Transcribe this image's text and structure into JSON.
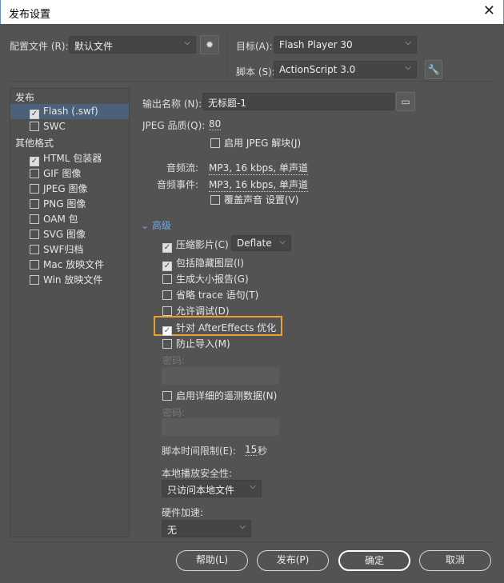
{
  "window": {
    "title": "发布设置",
    "close": "✕"
  },
  "top": {
    "profile_label": "配置文件 (R):",
    "profile_value": "默认文件",
    "target_label": "目标(A):",
    "target_value": "Flash Player 30",
    "script_label": "脚本 (S):",
    "script_value": "ActionScript 3.0"
  },
  "sidebar": {
    "publish_header": "发布",
    "publish_items": [
      {
        "label": "Flash (.swf)",
        "checked": true
      },
      {
        "label": "SWC",
        "checked": false
      }
    ],
    "other_header": "其他格式",
    "other_items": [
      {
        "label": "HTML 包装器",
        "checked": true
      },
      {
        "label": "GIF 图像",
        "checked": false
      },
      {
        "label": "JPEG 图像",
        "checked": false
      },
      {
        "label": "PNG 图像",
        "checked": false
      },
      {
        "label": "OAM 包",
        "checked": false
      },
      {
        "label": "SVG 图像",
        "checked": false
      },
      {
        "label": "SWF归档",
        "checked": false
      },
      {
        "label": "Mac 放映文件",
        "checked": false
      },
      {
        "label": "Win 放映文件",
        "checked": false
      }
    ]
  },
  "main": {
    "output_label": "输出名称 (N):",
    "output_value": "无标题-1",
    "jpeg_label": "JPEG 品质(Q):",
    "jpeg_value": "80",
    "jpeg_deblock": "启用 JPEG 解块(J)",
    "audio_stream_label": "音频流:",
    "audio_stream_value": "MP3, 16 kbps, 单声道",
    "audio_event_label": "音频事件:",
    "audio_event_value": "MP3, 16 kbps, 单声道",
    "override_sound": "覆盖声音 设置(V)",
    "advanced": "高级",
    "compress": "压缩影片(C)",
    "compress_value": "Deflate",
    "include_hidden": "包括隐藏图层(I)",
    "size_report": "生成大小报告(G)",
    "omit_trace": "省略 trace 语句(T)",
    "allow_debug": "允许调试(D)",
    "ae_optimize": "针对 AfterEffects 优化",
    "protect_import": "防止导入(M)",
    "password1": "密码:",
    "telemetry": "启用详细的遥测数据(N)",
    "password2": "密码:",
    "script_time_label": "脚本时间限制(E):",
    "script_time_value": "15",
    "script_time_unit": "秒",
    "local_security_label": "本地播放安全性:",
    "local_security_value": "只访问本地文件",
    "hw_accel_label": "硬件加速:",
    "hw_accel_value": "无"
  },
  "buttons": {
    "help": "帮助(L)",
    "publish": "发布(P)",
    "ok": "确定",
    "cancel": "取消"
  }
}
